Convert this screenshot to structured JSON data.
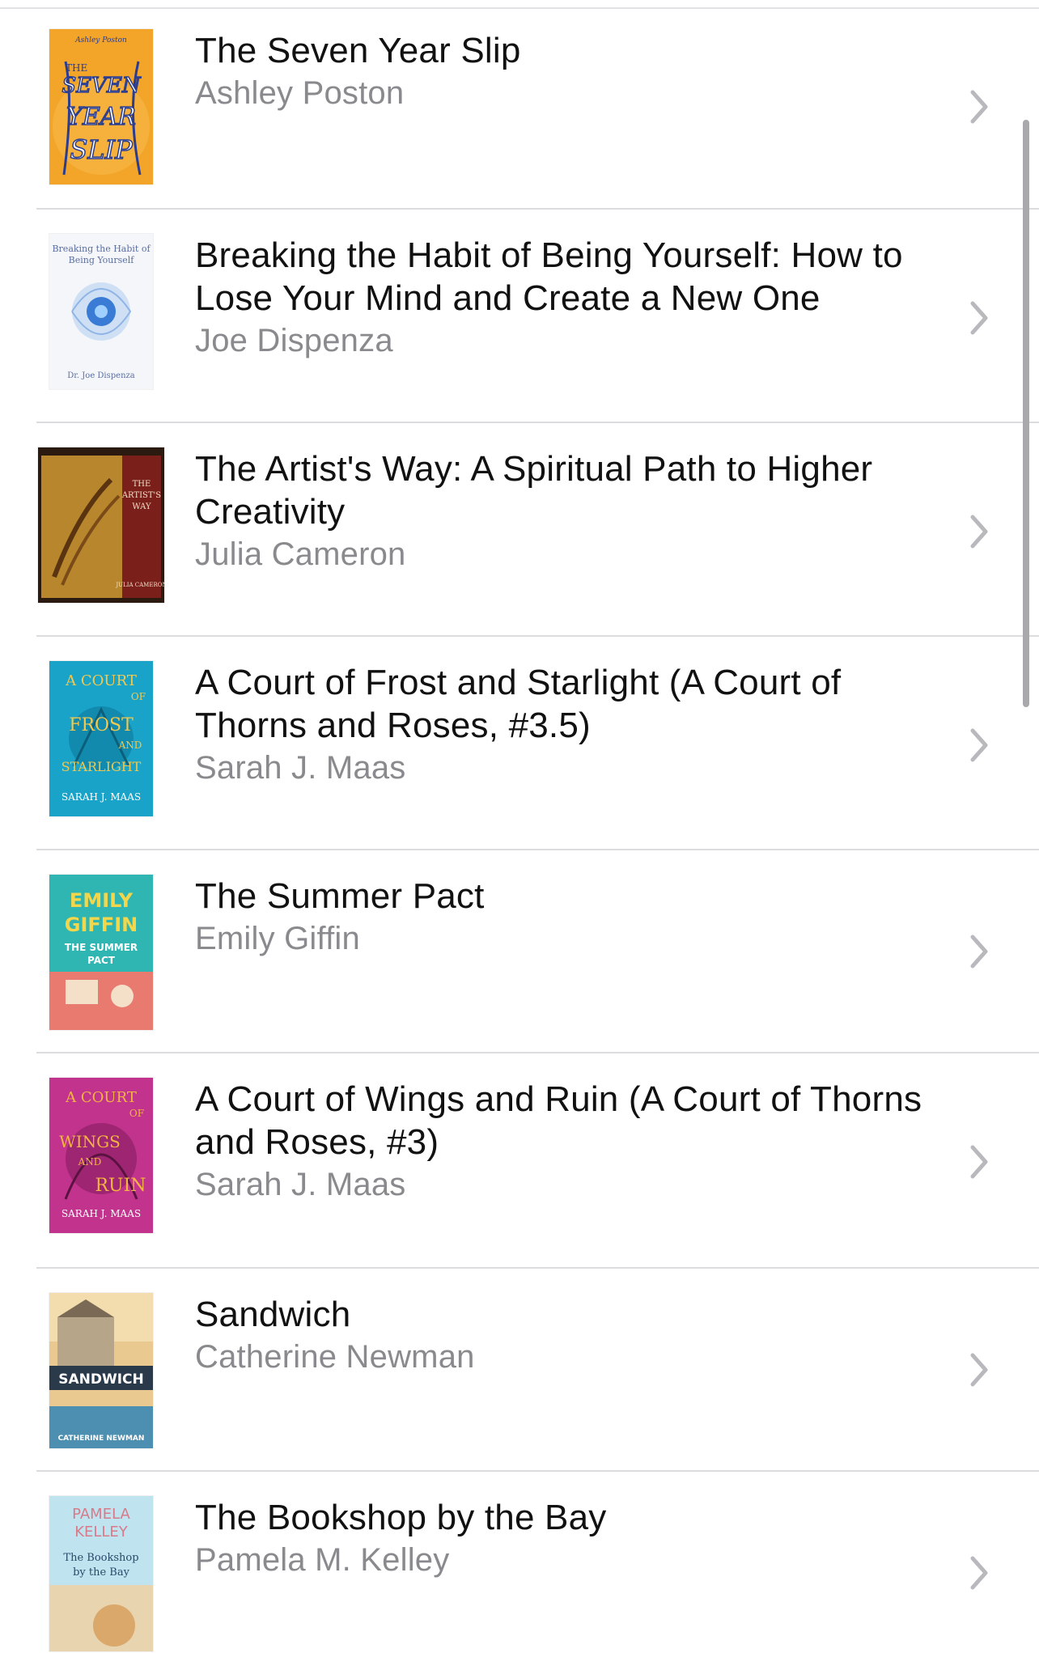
{
  "books": [
    {
      "title": "The Seven Year Slip",
      "author": "Ashley Poston",
      "cover": {
        "bg": "#f3a52a",
        "accent": "#2a3d8f",
        "lines": [
          "Ashley Poston",
          "THE",
          "SEVEN",
          "YEAR",
          "SLIP"
        ]
      }
    },
    {
      "title": "Breaking the Habit of Being Yourself: How to Lose Your Mind and Create a New One",
      "author": "Joe Dispenza",
      "cover": {
        "bg": "#f4f6fa",
        "accent": "#3a7bd5",
        "lines": [
          "Breaking the Habit of",
          "Being Yourself",
          "Dr. Joe Dispenza"
        ]
      }
    },
    {
      "title": "The Artist's Way: A Spiritual Path to Higher Creativity",
      "author": "Julia Cameron",
      "cover": {
        "bg": "#7a3a1a",
        "accent": "#d9a24a",
        "lines": [
          "THE",
          "ARTIST'S",
          "WAY",
          "JULIA CAMERON"
        ]
      }
    },
    {
      "title": "A Court of Frost and Starlight (A Court of Thorns and Roses, #3.5)",
      "author": "Sarah J. Maas",
      "cover": {
        "bg": "#1aa3c9",
        "accent": "#f2c94c",
        "lines": [
          "A COURT",
          "OF",
          "FROST",
          "AND",
          "STARLIGHT",
          "SARAH J. MAAS"
        ]
      }
    },
    {
      "title": "The Summer Pact",
      "author": "Emily Giffin",
      "cover": {
        "bg": "#2fb6b3",
        "accent": "#f2d64b",
        "lines": [
          "EMILY",
          "GIFFIN",
          "THE SUMMER",
          "PACT"
        ]
      }
    },
    {
      "title": "A Court of Wings and Ruin (A Court of Thorns and Roses, #3)",
      "author": "Sarah J. Maas",
      "cover": {
        "bg": "#c2338e",
        "accent": "#f3b441",
        "lines": [
          "A COURT",
          "OF",
          "WINGS",
          "AND",
          "RUIN",
          "SARAH J. MAAS"
        ]
      }
    },
    {
      "title": "Sandwich",
      "author": "Catherine Newman",
      "cover": {
        "bg": "#e9c98f",
        "accent": "#2b3a4a",
        "lines": [
          "SANDWICH",
          "CATHERINE NEWMAN"
        ]
      }
    },
    {
      "title": "The Bookshop by the Bay",
      "author": "Pamela M. Kelley",
      "cover": {
        "bg": "#bfe3ef",
        "accent": "#d77b8a",
        "lines": [
          "PAMELA",
          "KELLEY",
          "The Bookshop",
          "by the Bay"
        ]
      }
    }
  ],
  "icons": {
    "chevron": "chevron-right-icon"
  },
  "colors": {
    "title": "#111111",
    "author": "#8a8a8e",
    "separator": "#dcdcdf",
    "chevron": "#b9b9bd"
  }
}
